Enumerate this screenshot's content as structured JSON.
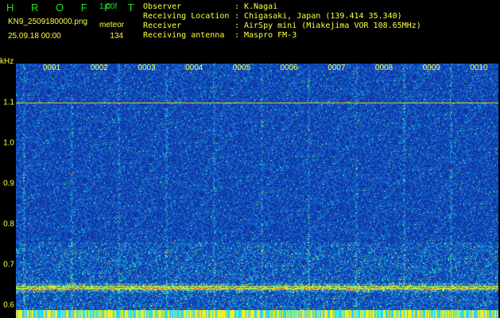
{
  "header": {
    "brand": "H R O F F T",
    "version": "1.00f",
    "filename": "KN9_2509180000.png",
    "meteor_label": "meteor",
    "date": "25.09.18 00:00",
    "count": "134"
  },
  "info": [
    {
      "key": "Observer",
      "value": "K.Nagai"
    },
    {
      "key": "Receiving Location",
      "value": "Chigasaki, Japan (139.414 35.340)"
    },
    {
      "key": "Receiver",
      "value": "AirSpy mini (Miakejima VOR 108.65MHz)"
    },
    {
      "key": "Receiving antenna",
      "value": "Maspro FM-3"
    }
  ],
  "separator": ":",
  "axis": {
    "unit": "kHz",
    "y_ticks": [
      {
        "label": "1.1",
        "value": 1.1
      },
      {
        "label": "1.0",
        "value": 1.0
      },
      {
        "label": "0.9",
        "value": 0.9
      },
      {
        "label": "0.8",
        "value": 0.8
      },
      {
        "label": "0.7",
        "value": 0.7
      },
      {
        "label": "0.6",
        "value": 0.6
      }
    ],
    "y_range": [
      0.585,
      1.195
    ],
    "x_ticks": [
      "0001",
      "0002",
      "0003",
      "0004",
      "0005",
      "0006",
      "0007",
      "0008",
      "0009",
      "0010"
    ]
  },
  "colors": {
    "label": "#ffff40",
    "brand": "#20e020",
    "background": "#1a3fb0",
    "ref_line": "#e8d020"
  },
  "signal": {
    "reference_line_khz": 1.1,
    "carrier_khz": 0.645
  }
}
